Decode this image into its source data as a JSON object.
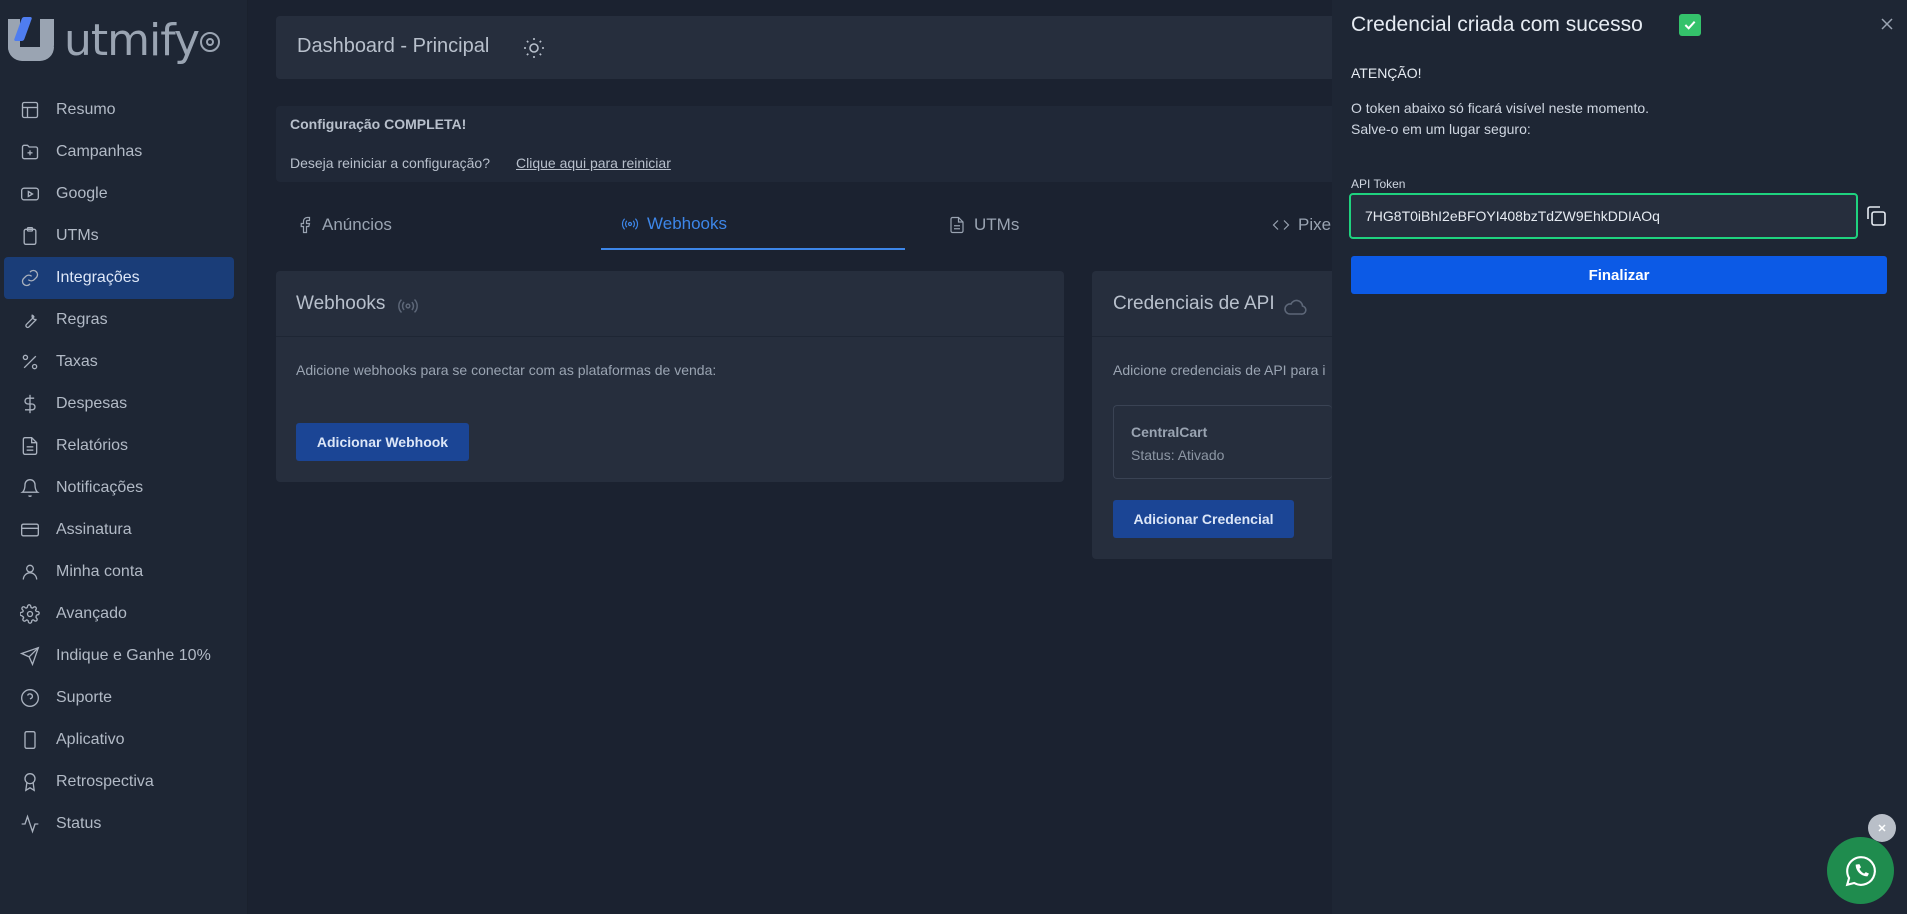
{
  "brand": {
    "name": "utmify"
  },
  "sidebar": {
    "items": [
      {
        "label": "Resumo",
        "icon": "layout-icon"
      },
      {
        "label": "Campanhas",
        "icon": "folder-plus-icon"
      },
      {
        "label": "Google",
        "icon": "video-icon"
      },
      {
        "label": "UTMs",
        "icon": "clipboard-icon"
      },
      {
        "label": "Integrações",
        "icon": "link-icon",
        "active": true
      },
      {
        "label": "Regras",
        "icon": "wrench-icon"
      },
      {
        "label": "Taxas",
        "icon": "percent-icon"
      },
      {
        "label": "Despesas",
        "icon": "dollar-icon"
      },
      {
        "label": "Relatórios",
        "icon": "file-icon"
      },
      {
        "label": "Notificações",
        "icon": "bell-icon"
      },
      {
        "label": "Assinatura",
        "icon": "credit-card-icon"
      },
      {
        "label": "Minha conta",
        "icon": "user-icon"
      },
      {
        "label": "Avançado",
        "icon": "gear-icon"
      },
      {
        "label": "Indique e Ganhe 10%",
        "icon": "send-icon"
      },
      {
        "label": "Suporte",
        "icon": "help-circle-icon"
      },
      {
        "label": "Aplicativo",
        "icon": "smartphone-icon"
      },
      {
        "label": "Retrospectiva",
        "icon": "award-icon"
      },
      {
        "label": "Status",
        "icon": "activity-icon"
      }
    ]
  },
  "header": {
    "title": "Dashboard - Principal"
  },
  "config": {
    "title": "Configuração COMPLETA!",
    "question": "Deseja reiniciar a configuração?",
    "link": "Clique aqui para reiniciar"
  },
  "tabs": [
    {
      "label": "Anúncios"
    },
    {
      "label": "Webhooks",
      "active": true
    },
    {
      "label": "UTMs"
    },
    {
      "label": "Pixe"
    }
  ],
  "webhooks_card": {
    "title": "Webhooks",
    "description": "Adicione webhooks para se conectar com as plataformas de venda:",
    "button": "Adicionar Webhook"
  },
  "credentials_card": {
    "title": "Credenciais de API",
    "description": "Adicione credenciais de API para i",
    "item_name": "CentralCart",
    "item_status": "Status: Ativado",
    "button": "Adicionar Credencial"
  },
  "drawer": {
    "title": "Credencial criada com sucesso",
    "attention": "ATENÇÃO!",
    "message_line1": "O token abaixo só ficará visível neste momento.",
    "message_line2": "Salve-o em um lugar seguro:",
    "token_label": "API Token",
    "token_value": "7HG8T0iBhI2eBFOYI408bzTdZW9EhkDDIAOq",
    "finish_button": "Finalizar"
  },
  "colors": {
    "accent": "#0c5ae6",
    "success": "#1fd27f",
    "whatsapp": "#1f8c4e"
  }
}
